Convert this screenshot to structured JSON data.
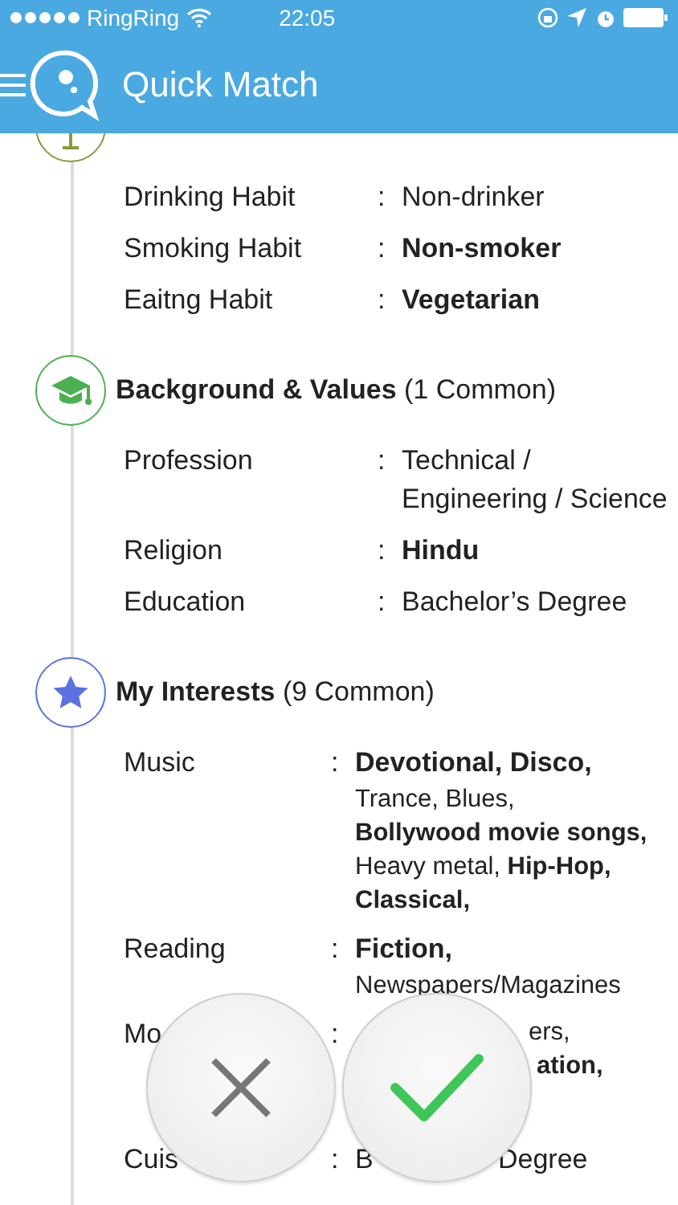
{
  "status_bar": {
    "carrier": "RingRing",
    "time": "22:05"
  },
  "nav": {
    "title": "Quick Match"
  },
  "sections": [
    {
      "kind": "glass",
      "color": "#8c9a3c",
      "rows": [
        {
          "label": "Drinking Habit",
          "sep": ":",
          "lines": [
            {
              "text": "Non-drinker",
              "bold": false
            }
          ]
        },
        {
          "label": "Smoking Habit",
          "sep": ":",
          "lines": [
            {
              "text": "Non-smoker",
              "bold": true
            }
          ]
        },
        {
          "label": "Eaitng Habit",
          "sep": ":",
          "lines": [
            {
              "text": "Vegetarian",
              "bold": true
            }
          ]
        }
      ]
    },
    {
      "kind": "cap",
      "color": "#4caf50",
      "title": "Background & Values",
      "count": "(1 Common)",
      "rows": [
        {
          "label": "Profession",
          "sep": ":",
          "lines": [
            {
              "text": "Technical /",
              "bold": false
            },
            {
              "text": "Engineering / Science",
              "bold": false
            }
          ]
        },
        {
          "label": "Religion",
          "sep": ":",
          "lines": [
            {
              "text": "Hindu",
              "bold": true
            }
          ]
        },
        {
          "label": "Education",
          "sep": ":",
          "lines": [
            {
              "text": "Bachelor’s Degree",
              "bold": false
            }
          ]
        }
      ]
    },
    {
      "kind": "star",
      "color": "#5b72e0",
      "title": "My Interests",
      "count": "(9 Common)",
      "rows": [
        {
          "label": "Music",
          "sep": ":",
          "lines": [
            {
              "text": "Devotional, Disco,",
              "bold": true
            },
            {
              "text": "Trance, Blues,",
              "bold": false
            },
            {
              "text": "Bollywood movie songs,",
              "bold": true
            },
            {
              "text": "Heavy metal, **Hip-Hop,**",
              "bold": false
            },
            {
              "text": "Classical,",
              "bold": true
            }
          ]
        },
        {
          "label": "Reading",
          "sep": ":",
          "lines": [
            {
              "text": "Fiction,",
              "bold": true
            },
            {
              "text": "Newspapers/Magazines",
              "bold": false
            }
          ]
        },
        {
          "label": "Mo",
          "sep": ":",
          "kind": "covered",
          "lines": [
            {
              "text": "ers,",
              "bold": false
            },
            {
              "text": "ation,",
              "bold": true
            }
          ]
        },
        {
          "label": "Cuis",
          "sep": ":",
          "kind": "split",
          "lines": [
            {
              "text": "B",
              "bold": false
            },
            {
              "text": "Degree",
              "bold": false
            }
          ]
        }
      ]
    }
  ],
  "actions": [
    {
      "kind": "reject"
    },
    {
      "kind": "accept"
    }
  ]
}
